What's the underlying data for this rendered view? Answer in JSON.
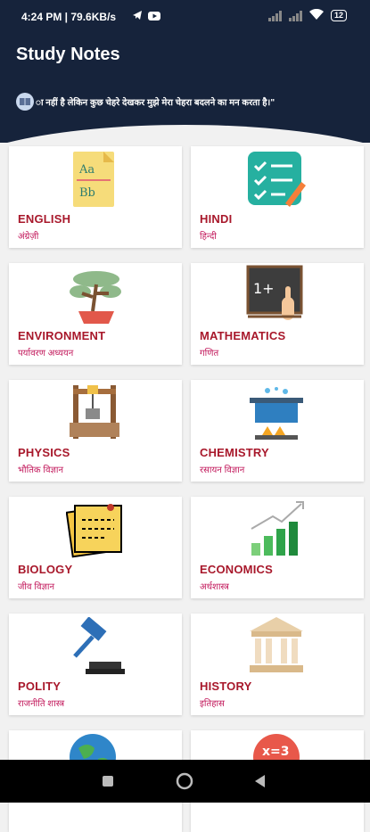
{
  "status_bar": {
    "time": "4:24 PM | 79.6KB/s",
    "battery": "12",
    "icons": [
      "telegram-icon",
      "youtube-icon",
      "signal-icon",
      "signal-icon",
      "wifi-icon",
      "battery-icon"
    ]
  },
  "app": {
    "title": "Study Notes"
  },
  "quote": {
    "text": "ा नहीं है लेकिन कुछ चेहरे देखकर मुझे मेरा चेहरा बदलने का मन करता है।\""
  },
  "subjects": [
    {
      "name": "ENGLISH",
      "sub": "अंग्रेज़ी",
      "icon": "notebook-icon"
    },
    {
      "name": "HINDI",
      "sub": "हिन्दी",
      "icon": "checklist-icon"
    },
    {
      "name": "ENVIRONMENT",
      "sub": "पर्यावरण अध्ययन",
      "icon": "bonsai-icon"
    },
    {
      "name": "MATHEMATICS",
      "sub": "गणित",
      "icon": "blackboard-icon"
    },
    {
      "name": "PHYSICS",
      "sub": "भौतिक विज्ञान",
      "icon": "well-icon"
    },
    {
      "name": "CHEMISTRY",
      "sub": "रसायन विज्ञान",
      "icon": "boiling-pot-icon"
    },
    {
      "name": "BIOLOGY",
      "sub": "जीव विज्ञान",
      "icon": "sticky-notes-icon"
    },
    {
      "name": "ECONOMICS",
      "sub": "अर्थशास्त्र",
      "icon": "growth-chart-icon"
    },
    {
      "name": "POLITY",
      "sub": "राजनीति शास्त्र",
      "icon": "gavel-icon"
    },
    {
      "name": "HISTORY",
      "sub": "इतिहास",
      "icon": "museum-icon"
    },
    {
      "name": "",
      "sub": "",
      "icon": "globe-icon"
    },
    {
      "name": "",
      "sub": "",
      "icon": "math-symbols-icon"
    }
  ],
  "nav": [
    "recents-button",
    "home-button",
    "back-button"
  ]
}
